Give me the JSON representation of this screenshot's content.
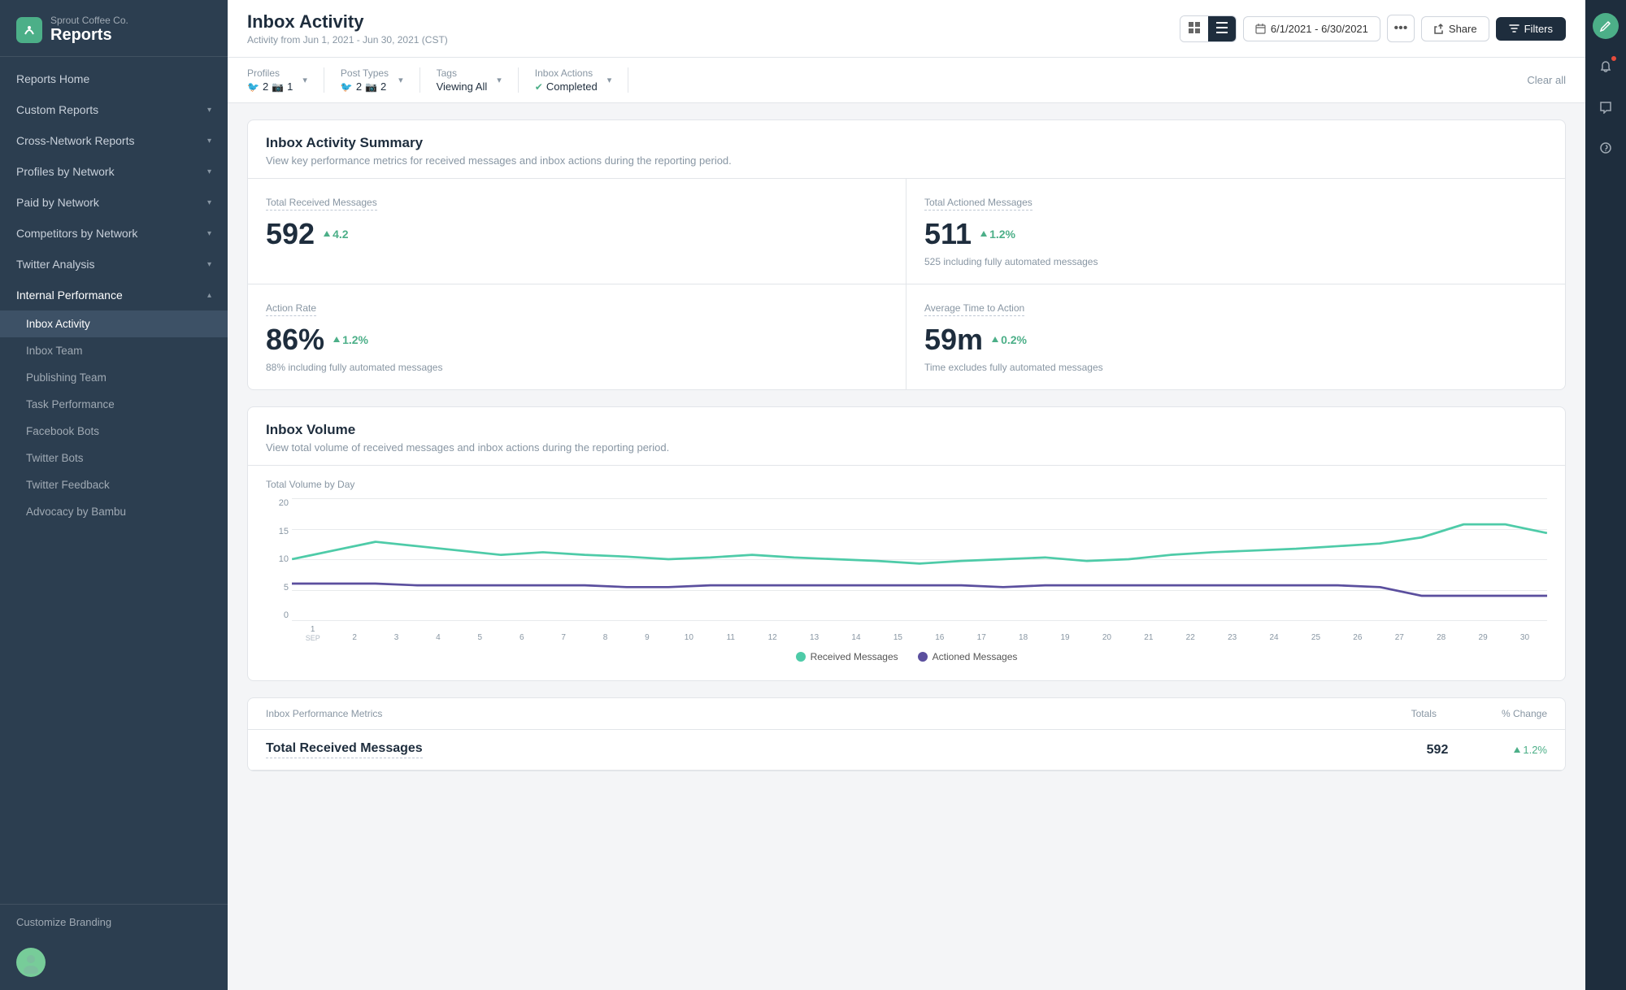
{
  "brand": {
    "company": "Sprout Coffee Co.",
    "title": "Reports"
  },
  "sidebar": {
    "nav_items": [
      {
        "label": "Reports Home",
        "id": "reports-home",
        "has_chevron": false
      },
      {
        "label": "Custom Reports",
        "id": "custom-reports",
        "has_chevron": true,
        "expanded": false
      },
      {
        "label": "Cross-Network Reports",
        "id": "cross-network",
        "has_chevron": true,
        "expanded": false
      },
      {
        "label": "Profiles by Network",
        "id": "profiles-by-network",
        "has_chevron": true,
        "expanded": false
      },
      {
        "label": "Paid by Network",
        "id": "paid-by-network",
        "has_chevron": true,
        "expanded": false
      },
      {
        "label": "Competitors by Network",
        "id": "competitors-by-network",
        "has_chevron": true,
        "expanded": false
      },
      {
        "label": "Twitter Analysis",
        "id": "twitter-analysis",
        "has_chevron": true,
        "expanded": false
      },
      {
        "label": "Internal Performance",
        "id": "internal-performance",
        "has_chevron": true,
        "expanded": true
      }
    ],
    "sub_items": [
      {
        "label": "Inbox Activity",
        "id": "inbox-activity",
        "active": true
      },
      {
        "label": "Inbox Team",
        "id": "inbox-team",
        "active": false
      },
      {
        "label": "Publishing Team",
        "id": "publishing-team",
        "active": false
      },
      {
        "label": "Task Performance",
        "id": "task-performance",
        "active": false
      },
      {
        "label": "Facebook Bots",
        "id": "facebook-bots",
        "active": false
      },
      {
        "label": "Twitter Bots",
        "id": "twitter-bots",
        "active": false
      },
      {
        "label": "Twitter Feedback",
        "id": "twitter-feedback",
        "active": false
      },
      {
        "label": "Advocacy by Bambu",
        "id": "advocacy-by-bambu",
        "active": false
      }
    ],
    "customize_branding": "Customize Branding"
  },
  "header": {
    "title": "Inbox Activity",
    "subtitle": "Activity from Jun 1, 2021 - Jun 30, 2021 (CST)",
    "date_range": "6/1/2021 - 6/30/2021",
    "share_label": "Share",
    "filters_label": "Filters"
  },
  "filters": {
    "profiles_label": "Profiles",
    "profiles_twitter_count": "2",
    "profiles_instagram_count": "1",
    "post_types_label": "Post Types",
    "post_types_twitter_count": "2",
    "post_types_instagram_count": "2",
    "tags_label": "Tags",
    "tags_value": "Viewing All",
    "inbox_actions_label": "Inbox Actions",
    "inbox_actions_value": "Completed",
    "clear_all": "Clear all"
  },
  "summary": {
    "card_title": "Inbox Activity Summary",
    "card_desc": "View key performance metrics for received messages and inbox actions during the reporting period.",
    "total_received_label": "Total Received Messages",
    "total_received_value": "592",
    "total_received_change": "4.2",
    "total_actioned_label": "Total Actioned Messages",
    "total_actioned_value": "511",
    "total_actioned_change": "1.2%",
    "total_actioned_sub": "525 including fully automated messages",
    "action_rate_label": "Action Rate",
    "action_rate_value": "86%",
    "action_rate_change": "1.2%",
    "action_rate_sub": "88% including fully automated messages",
    "avg_time_label": "Average Time to Action",
    "avg_time_value": "59m",
    "avg_time_change": "0.2%",
    "avg_time_sub": "Time excludes fully automated messages"
  },
  "volume": {
    "card_title": "Inbox Volume",
    "card_desc": "View total volume of received messages and inbox actions during the reporting period.",
    "chart_label": "Total Volume by Day",
    "y_labels": [
      "20",
      "15",
      "10",
      "5",
      "0"
    ],
    "x_labels": [
      "1",
      "2",
      "3",
      "4",
      "5",
      "6",
      "7",
      "8",
      "9",
      "10",
      "11",
      "12",
      "13",
      "14",
      "15",
      "16",
      "17",
      "18",
      "19",
      "20",
      "21",
      "22",
      "23",
      "24",
      "25",
      "26",
      "27",
      "28",
      "29",
      "30"
    ],
    "x_month": "SEP",
    "legend": [
      {
        "label": "Received Messages",
        "color": "#4ecba8"
      },
      {
        "label": "Actioned Messages",
        "color": "#5b4f9e"
      }
    ]
  },
  "metrics_table": {
    "header_label": "Inbox Performance Metrics",
    "header_totals": "Totals",
    "header_change": "% Change",
    "rows": [
      {
        "label": "Total Received Messages",
        "value": "592",
        "change": "1.2%"
      }
    ]
  },
  "colors": {
    "received": "#4ecba8",
    "actioned": "#5b4f9e",
    "accent": "#4caf88",
    "dark": "#1e2d3d"
  }
}
